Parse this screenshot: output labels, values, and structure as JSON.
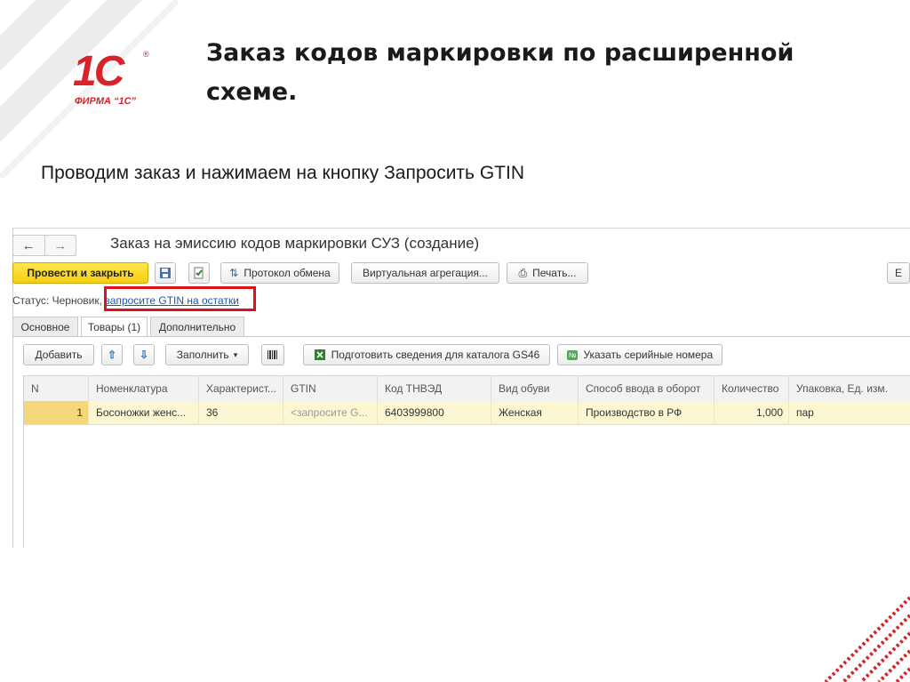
{
  "slide": {
    "title": "Заказ кодов маркировки по расширенной схеме.",
    "subtitle": "Проводим заказ и нажимаем на кнопку Запросить GTIN"
  },
  "logo": {
    "mark": "1C",
    "registered": "®",
    "firm": "ФИРМА “1С”"
  },
  "colors": {
    "brand_red": "#d8232a",
    "highlight_box": "#e0101a",
    "primary_button": "#f6cf12",
    "selected_row": "#fdf6d3",
    "link": "#1f57a6"
  },
  "window": {
    "back_icon": "arrow-left",
    "forward_icon": "arrow-right",
    "title": "Заказ на эмиссию кодов маркировки СУЗ (создание)"
  },
  "toolbar": {
    "post_close": "Провести и закрыть",
    "save_icon": "floppy-disk",
    "post_icon": "post-document",
    "exchange_log": "Протокол обмена",
    "virtual_aggregation": "Виртуальная агрегация...",
    "print": "Печать...",
    "more": "Е"
  },
  "status": {
    "label": "Статус:",
    "value": "Черновик,",
    "link": "запросите GTIN на остатки"
  },
  "tabs": [
    {
      "label": "Основное"
    },
    {
      "label": "Товары (1)"
    },
    {
      "label": "Дополнительно"
    }
  ],
  "table_toolbar": {
    "add": "Добавить",
    "up_icon": "arrow-up",
    "down_icon": "arrow-down",
    "fill": "Заполнить",
    "barcode_icon": "barcode",
    "prepare": "Подготовить сведения для каталога GS46",
    "serials": "Указать серийные номера"
  },
  "table": {
    "columns": [
      "N",
      "Номенклатура",
      "Характерист...",
      "GTIN",
      "Код ТНВЭД",
      "Вид обуви",
      "Способ ввода в оборот",
      "Количество",
      "Упаковка, Ед. изм."
    ],
    "rows": [
      {
        "n": "1",
        "nomenclature": "Босоножки женс...",
        "characteristic": "36",
        "gtin": "<запросите G...",
        "tnved": "6403999800",
        "shoe_type": "Женская",
        "entry_method": "Производство в РФ",
        "quantity": "1,000",
        "unit": "пар"
      }
    ]
  }
}
